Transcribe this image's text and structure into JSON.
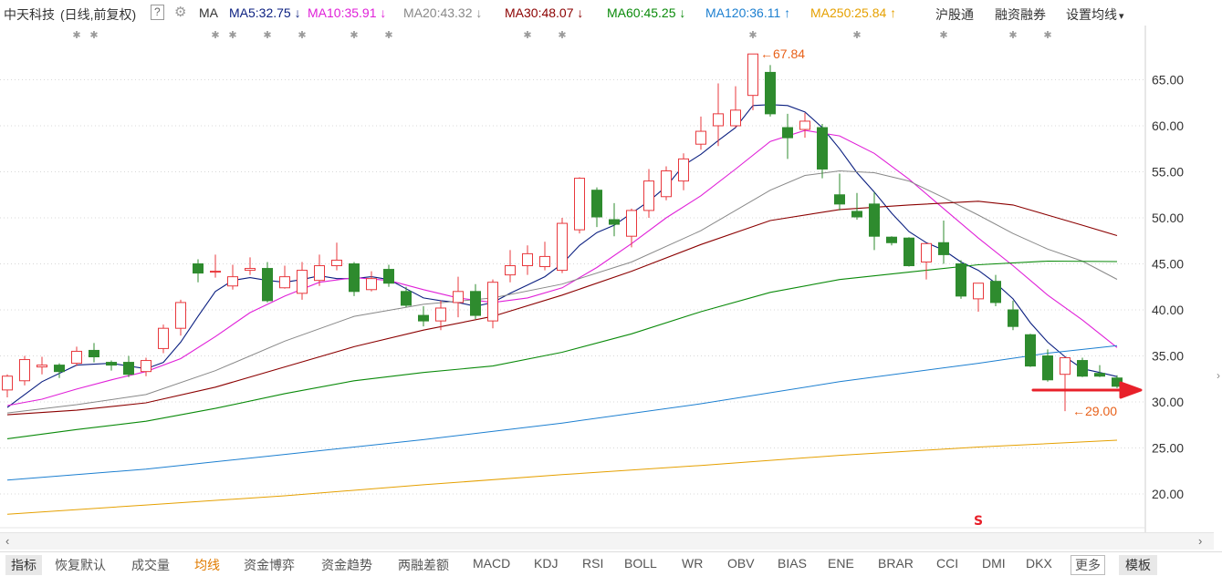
{
  "header": {
    "stock_name": "中天科技",
    "period": "(日线,前复权)",
    "help": "?",
    "ma_label": "MA",
    "ma_items": [
      {
        "label": "MA5:32.75",
        "arrow": "↓",
        "color": "#0b1f80"
      },
      {
        "label": "MA10:35.91",
        "arrow": "↓",
        "color": "#e020d8"
      },
      {
        "label": "MA20:43.32",
        "arrow": "↓",
        "color": "#888888"
      },
      {
        "label": "MA30:48.07",
        "arrow": "↓",
        "color": "#8b0000"
      },
      {
        "label": "MA60:45.25",
        "arrow": "↓",
        "color": "#0a8a0a"
      },
      {
        "label": "MA120:36.11",
        "arrow": "↑",
        "color": "#1c7fd0"
      },
      {
        "label": "MA250:25.84",
        "arrow": "↑",
        "color": "#e5a000"
      }
    ],
    "link_hgt": "沪股通",
    "link_margin": "融资融券",
    "settings": "设置均线",
    "settings_arrow": "▾"
  },
  "chart_data": {
    "type": "candlestick",
    "ylim": [
      17,
      69
    ],
    "y_ticks": [
      "65.00",
      "60.00",
      "55.00",
      "50.00",
      "45.00",
      "40.00",
      "35.00",
      "30.00",
      "25.00",
      "20.00"
    ],
    "y_tick_values": [
      65,
      60,
      55,
      50,
      45,
      40,
      35,
      30,
      25,
      20
    ],
    "colors": {
      "up": "#e8383d",
      "down": "#2e8b2e",
      "grid": "#d8d8d8",
      "axis_text": "#333333",
      "annotation": "#e8611a",
      "arrow": "#e8202a"
    },
    "candles": [
      {
        "o": 31.3,
        "h": 33.0,
        "l": 30.5,
        "c": 32.8
      },
      {
        "o": 32.3,
        "h": 35.0,
        "l": 31.8,
        "c": 34.6
      },
      {
        "o": 33.8,
        "h": 34.9,
        "l": 33.0,
        "c": 34.0
      },
      {
        "o": 34.0,
        "h": 34.2,
        "l": 32.6,
        "c": 33.3
      },
      {
        "o": 34.2,
        "h": 36.0,
        "l": 33.9,
        "c": 35.5
      },
      {
        "o": 35.6,
        "h": 36.4,
        "l": 34.3,
        "c": 34.9
      },
      {
        "o": 34.3,
        "h": 34.5,
        "l": 33.4,
        "c": 34.0
      },
      {
        "o": 34.3,
        "h": 35.0,
        "l": 32.7,
        "c": 33.0
      },
      {
        "o": 33.3,
        "h": 34.8,
        "l": 32.8,
        "c": 34.5
      },
      {
        "o": 35.8,
        "h": 38.4,
        "l": 35.3,
        "c": 38.0
      },
      {
        "o": 38.0,
        "h": 41.1,
        "l": 37.2,
        "c": 40.8
      },
      {
        "o": 45.0,
        "h": 45.5,
        "l": 43.0,
        "c": 44.0
      },
      {
        "o": 44.2,
        "h": 46.0,
        "l": 43.5,
        "c": 44.2
      },
      {
        "o": 42.6,
        "h": 44.9,
        "l": 42.2,
        "c": 43.6
      },
      {
        "o": 44.3,
        "h": 45.7,
        "l": 43.8,
        "c": 44.5
      },
      {
        "o": 44.5,
        "h": 45.2,
        "l": 40.8,
        "c": 41.0
      },
      {
        "o": 42.4,
        "h": 44.8,
        "l": 42.3,
        "c": 43.6
      },
      {
        "o": 41.8,
        "h": 45.2,
        "l": 41.1,
        "c": 44.3
      },
      {
        "o": 43.2,
        "h": 46.0,
        "l": 42.6,
        "c": 44.8
      },
      {
        "o": 44.8,
        "h": 47.3,
        "l": 44.3,
        "c": 45.4
      },
      {
        "o": 45.0,
        "h": 45.2,
        "l": 41.5,
        "c": 42.0
      },
      {
        "o": 42.2,
        "h": 44.2,
        "l": 42.0,
        "c": 43.4
      },
      {
        "o": 44.4,
        "h": 44.9,
        "l": 42.5,
        "c": 42.9
      },
      {
        "o": 42.0,
        "h": 42.5,
        "l": 40.3,
        "c": 40.5
      },
      {
        "o": 39.4,
        "h": 40.4,
        "l": 38.2,
        "c": 38.8
      },
      {
        "o": 38.8,
        "h": 41.0,
        "l": 37.8,
        "c": 40.2
      },
      {
        "o": 40.8,
        "h": 43.6,
        "l": 39.2,
        "c": 42.0
      },
      {
        "o": 42.0,
        "h": 42.8,
        "l": 39.0,
        "c": 39.4
      },
      {
        "o": 38.8,
        "h": 43.3,
        "l": 38.0,
        "c": 43.0
      },
      {
        "o": 43.8,
        "h": 46.5,
        "l": 43.0,
        "c": 44.8
      },
      {
        "o": 44.8,
        "h": 47.0,
        "l": 43.8,
        "c": 46.1
      },
      {
        "o": 44.7,
        "h": 47.4,
        "l": 44.3,
        "c": 45.8
      },
      {
        "o": 44.3,
        "h": 50.0,
        "l": 44.0,
        "c": 49.4
      },
      {
        "o": 48.7,
        "h": 54.4,
        "l": 48.3,
        "c": 54.3
      },
      {
        "o": 53.0,
        "h": 53.3,
        "l": 49.0,
        "c": 50.1
      },
      {
        "o": 49.8,
        "h": 51.6,
        "l": 48.0,
        "c": 49.3
      },
      {
        "o": 48.0,
        "h": 51.0,
        "l": 46.8,
        "c": 50.8
      },
      {
        "o": 50.8,
        "h": 55.3,
        "l": 50.0,
        "c": 54.0
      },
      {
        "o": 52.3,
        "h": 55.6,
        "l": 51.9,
        "c": 55.1
      },
      {
        "o": 54.0,
        "h": 57.0,
        "l": 53.0,
        "c": 56.4
      },
      {
        "o": 58.0,
        "h": 61.0,
        "l": 57.4,
        "c": 59.4
      },
      {
        "o": 60.0,
        "h": 64.6,
        "l": 57.8,
        "c": 61.3
      },
      {
        "o": 60.0,
        "h": 64.3,
        "l": 59.8,
        "c": 61.7
      },
      {
        "o": 63.3,
        "h": 67.8,
        "l": 61.7,
        "c": 67.8
      },
      {
        "o": 65.8,
        "h": 66.6,
        "l": 61.0,
        "c": 61.3
      },
      {
        "o": 59.8,
        "h": 61.3,
        "l": 56.4,
        "c": 58.7
      },
      {
        "o": 59.6,
        "h": 61.4,
        "l": 58.7,
        "c": 60.5
      },
      {
        "o": 59.8,
        "h": 60.2,
        "l": 54.3,
        "c": 55.3
      },
      {
        "o": 52.5,
        "h": 54.8,
        "l": 50.8,
        "c": 51.5
      },
      {
        "o": 50.7,
        "h": 52.7,
        "l": 49.8,
        "c": 50.1
      },
      {
        "o": 51.5,
        "h": 52.8,
        "l": 46.5,
        "c": 48.0
      },
      {
        "o": 47.9,
        "h": 48.0,
        "l": 47.0,
        "c": 47.3
      },
      {
        "o": 47.8,
        "h": 47.9,
        "l": 44.7,
        "c": 44.8
      },
      {
        "o": 45.2,
        "h": 47.0,
        "l": 43.3,
        "c": 47.2
      },
      {
        "o": 47.3,
        "h": 49.7,
        "l": 45.0,
        "c": 46.0
      },
      {
        "o": 45.0,
        "h": 45.4,
        "l": 41.2,
        "c": 41.5
      },
      {
        "o": 41.2,
        "h": 42.7,
        "l": 39.8,
        "c": 42.9
      },
      {
        "o": 43.1,
        "h": 43.8,
        "l": 40.4,
        "c": 40.8
      },
      {
        "o": 40.0,
        "h": 41.0,
        "l": 37.8,
        "c": 38.2
      },
      {
        "o": 37.3,
        "h": 37.4,
        "l": 33.8,
        "c": 33.9
      },
      {
        "o": 35.0,
        "h": 35.7,
        "l": 32.2,
        "c": 32.4
      },
      {
        "o": 33.0,
        "h": 34.9,
        "l": 29.0,
        "c": 34.8
      },
      {
        "o": 34.5,
        "h": 34.8,
        "l": 32.7,
        "c": 32.8
      },
      {
        "o": 33.1,
        "h": 34.0,
        "l": 32.7,
        "c": 32.8
      },
      {
        "o": 32.6,
        "h": 32.9,
        "l": 31.5,
        "c": 31.7
      }
    ],
    "ma_lines": [
      {
        "name": "MA5",
        "color": "#0b1f80",
        "width": 1.1,
        "points": [
          [
            0,
            29.4
          ],
          [
            2,
            32.2
          ],
          [
            4,
            34.0
          ],
          [
            6,
            34.2
          ],
          [
            8,
            33.6
          ],
          [
            9,
            34.3
          ],
          [
            10,
            36.5
          ],
          [
            11,
            39.3
          ],
          [
            12,
            42.0
          ],
          [
            13,
            43.2
          ],
          [
            14,
            43.5
          ],
          [
            15,
            43.2
          ],
          [
            16,
            43.0
          ],
          [
            17,
            43.3
          ],
          [
            18,
            43.7
          ],
          [
            19,
            43.4
          ],
          [
            20,
            43.4
          ],
          [
            21,
            43.6
          ],
          [
            22,
            43.3
          ],
          [
            23,
            42.3
          ],
          [
            24,
            41.3
          ],
          [
            25,
            41.0
          ],
          [
            26,
            40.8
          ],
          [
            27,
            40.4
          ],
          [
            28,
            40.8
          ],
          [
            29,
            41.8
          ],
          [
            30,
            42.7
          ],
          [
            31,
            43.6
          ],
          [
            32,
            45.0
          ],
          [
            33,
            47.0
          ],
          [
            34,
            48.4
          ],
          [
            35,
            49.2
          ],
          [
            36,
            50.5
          ],
          [
            37,
            51.8
          ],
          [
            38,
            53.4
          ],
          [
            39,
            55.7
          ],
          [
            40,
            56.9
          ],
          [
            41,
            58.4
          ],
          [
            42,
            59.8
          ],
          [
            43,
            62.2
          ],
          [
            44,
            62.3
          ],
          [
            45,
            62.2
          ],
          [
            46,
            61.5
          ],
          [
            47,
            59.8
          ],
          [
            48,
            57.5
          ],
          [
            49,
            54.9
          ],
          [
            50,
            52.8
          ],
          [
            51,
            50.5
          ],
          [
            52,
            48.5
          ],
          [
            53,
            47.3
          ],
          [
            54,
            46.5
          ],
          [
            55,
            45.2
          ],
          [
            56,
            44.3
          ],
          [
            57,
            42.9
          ],
          [
            58,
            41.2
          ],
          [
            59,
            38.6
          ],
          [
            60,
            36.5
          ],
          [
            61,
            34.9
          ],
          [
            62,
            33.6
          ],
          [
            63,
            33.2
          ],
          [
            64,
            32.75
          ]
        ]
      },
      {
        "name": "MA10",
        "color": "#e020d8",
        "width": 1.1,
        "points": [
          [
            0,
            29.6
          ],
          [
            2,
            30.3
          ],
          [
            4,
            31.4
          ],
          [
            6,
            32.4
          ],
          [
            8,
            33.3
          ],
          [
            10,
            34.7
          ],
          [
            12,
            37.1
          ],
          [
            14,
            39.7
          ],
          [
            16,
            41.5
          ],
          [
            18,
            43.0
          ],
          [
            20,
            43.5
          ],
          [
            22,
            43.2
          ],
          [
            24,
            42.2
          ],
          [
            26,
            41.3
          ],
          [
            28,
            40.8
          ],
          [
            30,
            41.3
          ],
          [
            32,
            42.4
          ],
          [
            34,
            44.6
          ],
          [
            36,
            47.2
          ],
          [
            38,
            50.0
          ],
          [
            40,
            52.4
          ],
          [
            42,
            55.3
          ],
          [
            44,
            58.3
          ],
          [
            46,
            59.5
          ],
          [
            48,
            58.9
          ],
          [
            50,
            57.0
          ],
          [
            52,
            54.2
          ],
          [
            54,
            51.0
          ],
          [
            56,
            47.8
          ],
          [
            58,
            44.8
          ],
          [
            60,
            41.6
          ],
          [
            62,
            38.9
          ],
          [
            64,
            35.91
          ]
        ]
      },
      {
        "name": "MA20",
        "color": "#888888",
        "width": 1.0,
        "points": [
          [
            0,
            28.8
          ],
          [
            4,
            29.7
          ],
          [
            8,
            30.8
          ],
          [
            12,
            33.4
          ],
          [
            16,
            36.6
          ],
          [
            20,
            39.3
          ],
          [
            24,
            40.6
          ],
          [
            28,
            41.3
          ],
          [
            32,
            42.8
          ],
          [
            36,
            45.2
          ],
          [
            40,
            48.6
          ],
          [
            44,
            53.0
          ],
          [
            46,
            54.6
          ],
          [
            48,
            55.1
          ],
          [
            50,
            54.9
          ],
          [
            52,
            54.0
          ],
          [
            54,
            52.2
          ],
          [
            56,
            50.3
          ],
          [
            58,
            48.3
          ],
          [
            60,
            46.6
          ],
          [
            62,
            45.3
          ],
          [
            64,
            43.32
          ]
        ]
      },
      {
        "name": "MA30",
        "color": "#8b0000",
        "width": 1.1,
        "points": [
          [
            0,
            28.6
          ],
          [
            4,
            29.1
          ],
          [
            8,
            29.9
          ],
          [
            12,
            31.6
          ],
          [
            16,
            33.8
          ],
          [
            20,
            36.0
          ],
          [
            24,
            37.8
          ],
          [
            28,
            39.3
          ],
          [
            32,
            41.6
          ],
          [
            36,
            44.2
          ],
          [
            40,
            47.1
          ],
          [
            44,
            49.7
          ],
          [
            48,
            50.9
          ],
          [
            52,
            51.4
          ],
          [
            56,
            51.8
          ],
          [
            58,
            51.4
          ],
          [
            60,
            50.3
          ],
          [
            62,
            49.2
          ],
          [
            64,
            48.07
          ]
        ]
      },
      {
        "name": "MA60",
        "color": "#0a8a0a",
        "width": 1.1,
        "points": [
          [
            0,
            26.0
          ],
          [
            4,
            27.0
          ],
          [
            8,
            27.9
          ],
          [
            12,
            29.3
          ],
          [
            16,
            30.9
          ],
          [
            20,
            32.3
          ],
          [
            24,
            33.2
          ],
          [
            28,
            33.9
          ],
          [
            32,
            35.4
          ],
          [
            36,
            37.4
          ],
          [
            40,
            39.8
          ],
          [
            44,
            41.9
          ],
          [
            48,
            43.3
          ],
          [
            52,
            44.1
          ],
          [
            56,
            44.9
          ],
          [
            60,
            45.3
          ],
          [
            64,
            45.25
          ]
        ]
      },
      {
        "name": "MA120",
        "color": "#1c7fd0",
        "width": 1.0,
        "points": [
          [
            0,
            21.5
          ],
          [
            8,
            22.7
          ],
          [
            16,
            24.3
          ],
          [
            24,
            25.9
          ],
          [
            32,
            27.7
          ],
          [
            40,
            29.8
          ],
          [
            48,
            32.2
          ],
          [
            56,
            34.2
          ],
          [
            60,
            35.3
          ],
          [
            64,
            36.11
          ]
        ]
      },
      {
        "name": "MA250",
        "color": "#e5a000",
        "width": 1.0,
        "points": [
          [
            0,
            17.8
          ],
          [
            8,
            18.8
          ],
          [
            16,
            19.8
          ],
          [
            24,
            21.0
          ],
          [
            32,
            22.1
          ],
          [
            40,
            23.1
          ],
          [
            48,
            24.2
          ],
          [
            56,
            25.1
          ],
          [
            64,
            25.84
          ]
        ]
      }
    ],
    "annotations": [
      {
        "text": "←67.84",
        "candle": 43,
        "value": 67.84
      },
      {
        "text": "←29.00",
        "candle": 61,
        "value": 29.0
      }
    ],
    "marker_s": "S",
    "marker_s_candle": 56,
    "event_marks_top": "✱"
  },
  "bottom_tabs": [
    "指标",
    "恢复默认",
    "成交量",
    "均线",
    "资金博弈",
    "资金趋势",
    "两融差额",
    "MACD",
    "KDJ",
    "RSI",
    "BOLL",
    "WR",
    "OBV",
    "BIAS",
    "ENE",
    "BRAR",
    "CCI",
    "DMI",
    "DKX",
    "更多",
    "模板"
  ],
  "scrollbar": {
    "left": "‹",
    "right": "›"
  },
  "side_grip": "›"
}
